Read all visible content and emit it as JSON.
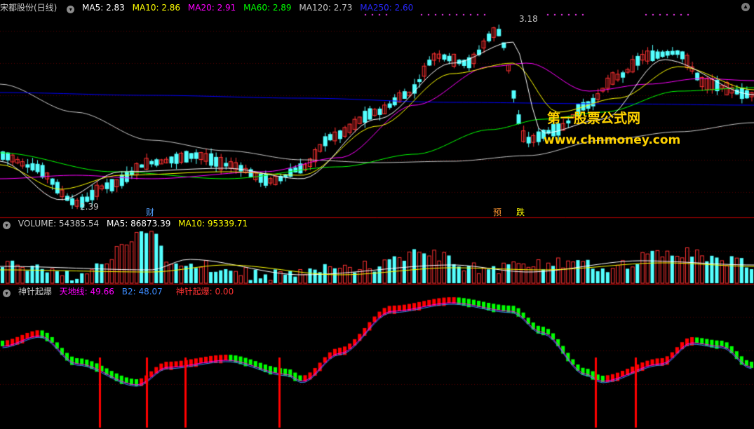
{
  "main": {
    "title": "宋都股份(日线)",
    "indicators": [
      {
        "label": "MA5: 2.83",
        "color": "#ffffff"
      },
      {
        "label": "MA10: 2.86",
        "color": "#ffff00"
      },
      {
        "label": "MA20: 2.91",
        "color": "#ff00ff"
      },
      {
        "label": "MA60: 2.89",
        "color": "#00ff00"
      },
      {
        "label": "MA120: 2.73",
        "color": "#c8c8c8"
      },
      {
        "label": "MA250: 2.60",
        "color": "#0000ff"
      }
    ],
    "high_label": "3.18",
    "low_label": "2.39",
    "marker_cai": "财",
    "marker_yu": "预",
    "marker_die": "跌"
  },
  "volume": {
    "title": "VOLUME: 54385.54",
    "ma5": "MA5: 86873.39",
    "ma10": "MA10: 95339.71"
  },
  "indicator": {
    "title": "神针起爆",
    "tiandi": "天地线: 49.66",
    "b2": "B2: 48.07",
    "shenzhen": "神针起爆: 0.00"
  },
  "watermark": {
    "line1": "第一股票公式网",
    "line2": "www.chnmoney.com"
  },
  "colors": {
    "up": "#ff3232",
    "down": "#54ffff",
    "ma5": "#ffffff",
    "ma10": "#ffff00",
    "ma20": "#ff00ff",
    "ma60": "#00ff00",
    "ma120": "#c8c8c8",
    "ma250": "#0000ff",
    "indicator_up": "#ff0000",
    "indicator_down": "#00ff00",
    "panel_border": "#b40000"
  }
}
